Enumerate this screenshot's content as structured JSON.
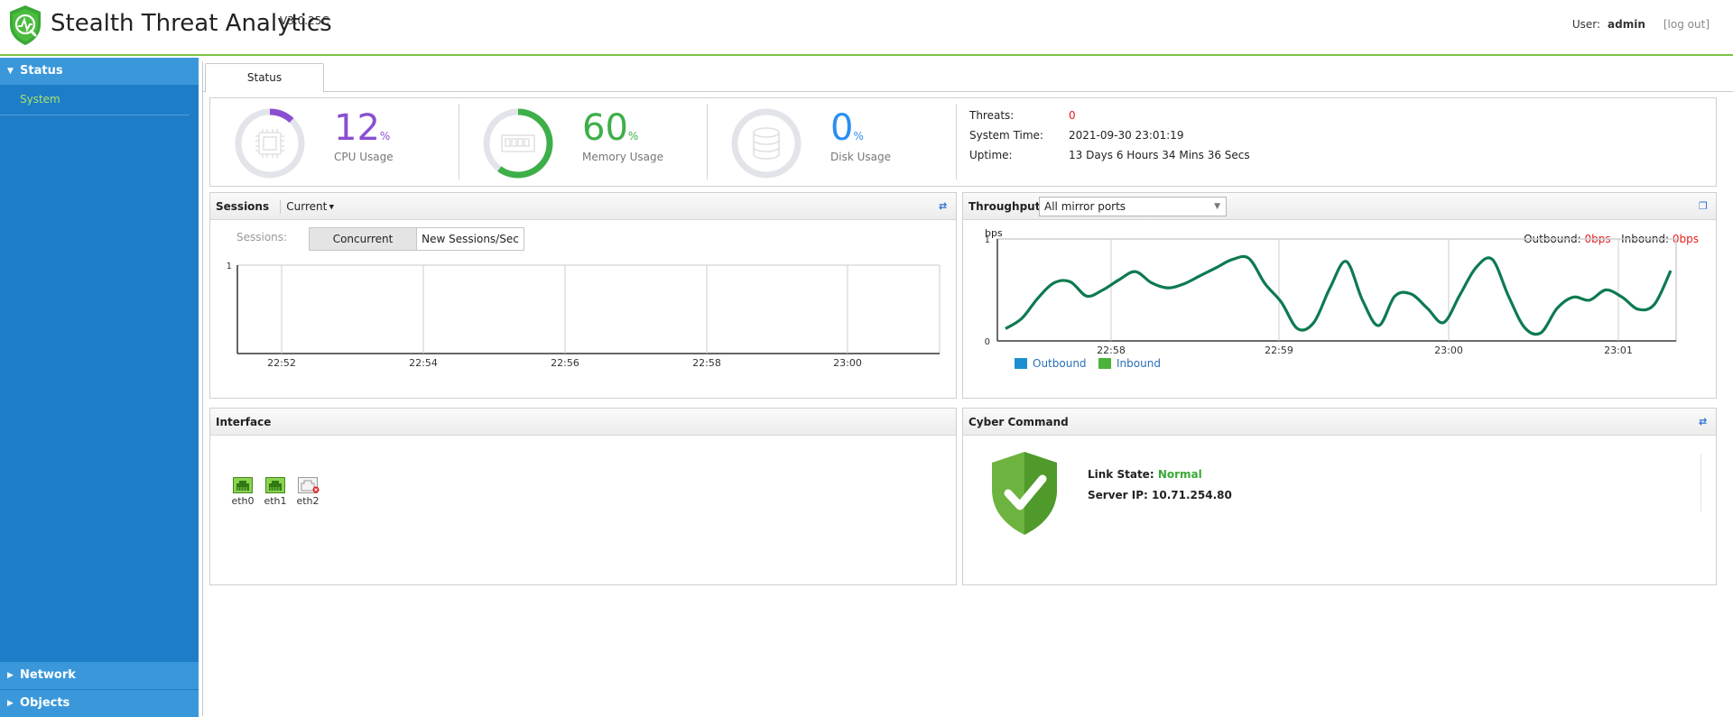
{
  "header": {
    "title": "Stealth Threat Analytics",
    "version": "V3.0.25C",
    "user_label": "User:",
    "user_name": "admin",
    "logout_label": "[log out]",
    "accent_color": "#7dc243"
  },
  "sidebar": {
    "status_label": "Status",
    "system_label": "System",
    "network_label": "Network",
    "objects_label": "Objects",
    "bg_color": "#1e7dc7"
  },
  "tabs": {
    "status": "Status"
  },
  "summary": {
    "cpu": {
      "value": "12",
      "unit": "%",
      "label": "CPU Usage",
      "fraction": 0.12,
      "color": "#8a4fd0"
    },
    "memory": {
      "value": "60",
      "unit": "%",
      "label": "Memory Usage",
      "fraction": 0.6,
      "color": "#3daf48"
    },
    "disk": {
      "value": "0",
      "unit": "%",
      "label": "Disk Usage",
      "fraction": 0.0,
      "color": "#2b8ef0"
    },
    "threats_label": "Threats:",
    "threats_value": "0",
    "system_time_label": "System Time:",
    "system_time_value": "2021-09-30 23:01:19",
    "uptime_label": "Uptime:",
    "uptime_value": "13 Days 6 Hours 34 Mins 36 Secs"
  },
  "sessions": {
    "title": "Sessions",
    "filter": "Current",
    "sessions_label": "Sessions:",
    "concurrent_label": "Concurrent",
    "new_sessions_label": "New Sessions/Sec"
  },
  "throughput": {
    "title": "Throughput",
    "port_select": "All mirror ports",
    "outbound_label": "Outbound:",
    "outbound_value": "0bps",
    "inbound_label": "Inbound:",
    "inbound_value": "0bps"
  },
  "interface": {
    "title": "Interface",
    "ports": [
      {
        "name": "eth0",
        "state": "up"
      },
      {
        "name": "eth1",
        "state": "up"
      },
      {
        "name": "eth2",
        "state": "down"
      }
    ]
  },
  "cyber": {
    "title": "Cyber Command",
    "link_state_label": "Link State:",
    "link_state_value": "Normal",
    "server_ip_label": "Server IP:",
    "server_ip_value": "10.71.254.80"
  },
  "chart_data": [
    {
      "type": "line",
      "name": "sessions",
      "x_ticks": [
        "22:52",
        "22:54",
        "22:56",
        "22:58",
        "23:00"
      ],
      "ylim": [
        0,
        1
      ],
      "y_ticks": [
        "1"
      ],
      "series": [],
      "grid": true
    },
    {
      "type": "line",
      "name": "throughput",
      "ylabel": "bps",
      "ylim": [
        0,
        1
      ],
      "y_ticks": [
        "1",
        "0"
      ],
      "x_ticks": [
        "22:58",
        "22:59",
        "23:00",
        "23:01"
      ],
      "legend": [
        "Outbound",
        "Inbound"
      ],
      "legend_colors": [
        "#1d8ecf",
        "#4cb33a"
      ],
      "legend_position": "bottom-left",
      "grid": true,
      "series": [
        {
          "name": "Inbound",
          "color": "#0d7a50",
          "values": [
            0.12,
            0.22,
            0.42,
            0.57,
            0.58,
            0.44,
            0.5,
            0.6,
            0.68,
            0.57,
            0.52,
            0.56,
            0.64,
            0.72,
            0.8,
            0.81,
            0.56,
            0.38,
            0.12,
            0.18,
            0.52,
            0.78,
            0.4,
            0.15,
            0.44,
            0.46,
            0.32,
            0.18,
            0.45,
            0.72,
            0.8,
            0.44,
            0.13,
            0.08,
            0.32,
            0.43,
            0.4,
            0.5,
            0.43,
            0.31,
            0.36,
            0.69
          ]
        }
      ]
    }
  ]
}
